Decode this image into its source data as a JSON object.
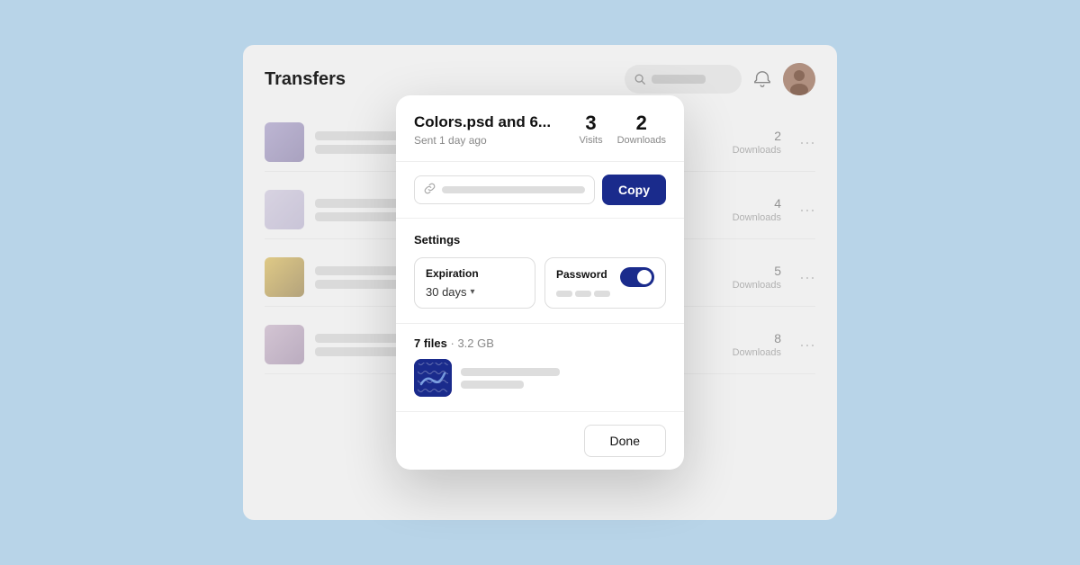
{
  "app": {
    "title": "Transfers",
    "search_placeholder": "Search"
  },
  "modal": {
    "title": "Colors.psd and 6...",
    "subtitle": "Sent 1 day ago",
    "stats": {
      "visits_count": "3",
      "visits_label": "Visits",
      "downloads_count": "2",
      "downloads_label": "Downloads"
    },
    "link_placeholder": "",
    "copy_button": "Copy",
    "settings": {
      "title": "Settings",
      "expiration_label": "Expiration",
      "expiration_value": "30 days",
      "password_label": "Password"
    },
    "files": {
      "count": "7 files",
      "size": "3.2 GB"
    },
    "done_button": "Done"
  },
  "bg_items": [
    {
      "downloads": "2",
      "downloads_label": "Downloads",
      "color1": "#9b8fc0",
      "color2": "#7b6fa0"
    },
    {
      "downloads": "4",
      "downloads_label": "Downloads",
      "color1": "#c8c0d8",
      "color2": "#b0a8c8"
    },
    {
      "downloads": "5",
      "downloads_label": "Downloads",
      "color1": "#d4b040",
      "color2": "#8c7030"
    },
    {
      "downloads": "8",
      "downloads_label": "Downloads",
      "color1": "#c0a8c0",
      "color2": "#9880a0"
    }
  ]
}
